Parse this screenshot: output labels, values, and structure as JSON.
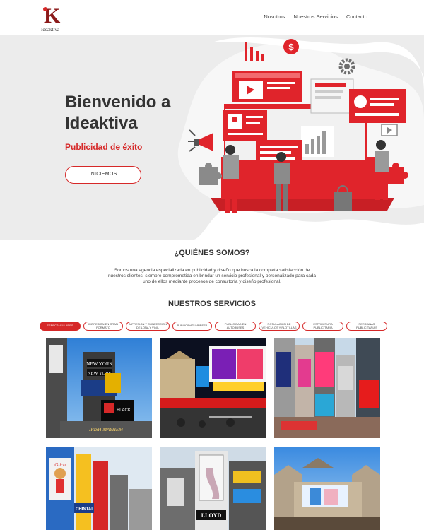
{
  "brand": {
    "mark": "K",
    "name": "Ideaktiva"
  },
  "nav": {
    "items": [
      "Nosotros",
      "Nuestros Servicios",
      "Contacto"
    ]
  },
  "hero": {
    "title": "Bienvenido a Ideaktiva",
    "subtitle": "Publicidad de éxito",
    "cta": "INICIEMOS"
  },
  "who": {
    "title": "¿QUIÉNES SOMOS?",
    "text": "Somos una agencia especializada en publicidad y diseño que busca la completa satisfacción de nuestros clientes, siempre comprometida en brindar un servicio profesional y personalizado para cada uno de ellos mediante procesos de consultoría y diseño profesional."
  },
  "services": {
    "title": "NUESTROS SERVICIOS",
    "tabs": [
      "ESPECTACULARES",
      "IMPRESION EN GRAN FORMATO",
      "IMPRESION Y CONFECCION DE LONA Y VINIL",
      "PUBLICIDAD IMPRESA",
      "PUBLICIDAD EN AUTOBUSES",
      "ROTULACIÓN DE VEHICULOS Y FLOTILLAS",
      "ESTRUCTURA PUBLICITARIA",
      "PERSIANAS PUBLICITARIAS"
    ],
    "active_tab": "ESPECTACULARES"
  },
  "photos": {
    "p1": {
      "sign1": "NEW YORK",
      "sign2": "NEW YORK",
      "sign3": "BLACK",
      "sign4": "IRISH MAYHEM"
    },
    "p5": {
      "sign1": "CHINTAI",
      "sign2": "Glico"
    },
    "p6": {
      "sign1": "LLOYD"
    }
  },
  "colors": {
    "accent": "#d62828",
    "hero_bg": "#ececec",
    "text": "#333333"
  }
}
